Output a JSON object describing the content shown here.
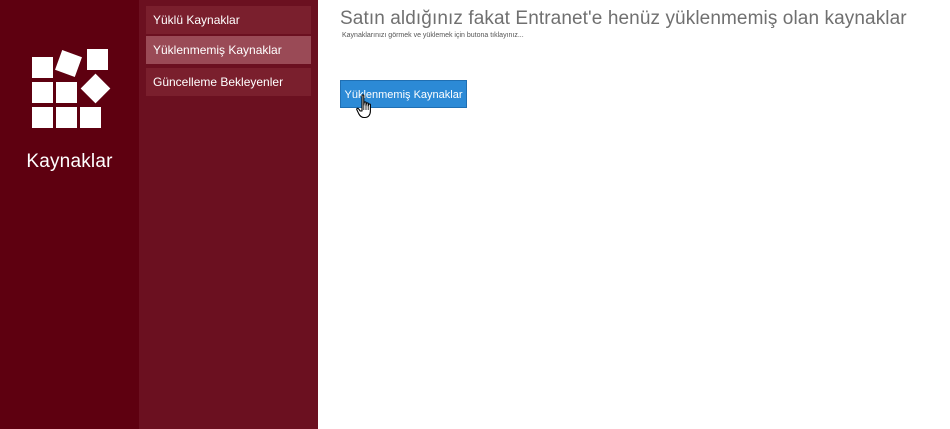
{
  "brand": {
    "title": "Kaynaklar",
    "logo_icon": "tiles-icon",
    "color": "#5e0010"
  },
  "nav": {
    "items": [
      {
        "label": "Yüklü Kaynaklar",
        "active": false
      },
      {
        "label": "Yüklenmemiş Kaynaklar",
        "active": true
      },
      {
        "label": "Güncelleme Bekleyenler",
        "active": false
      }
    ],
    "color": "#6b1020",
    "active_color": "#9a4a56"
  },
  "main": {
    "title": "Satın aldığınız fakat Entranet'e henüz yüklenmemiş olan kaynaklar",
    "subtitle": "Kaynaklarınızı görmek ve yüklemek için butona tıklayınız...",
    "button_label": "Yüklenmemiş Kaynaklar",
    "button_color": "#2c8ad6"
  },
  "cursor_icon": "hand-pointer-icon"
}
